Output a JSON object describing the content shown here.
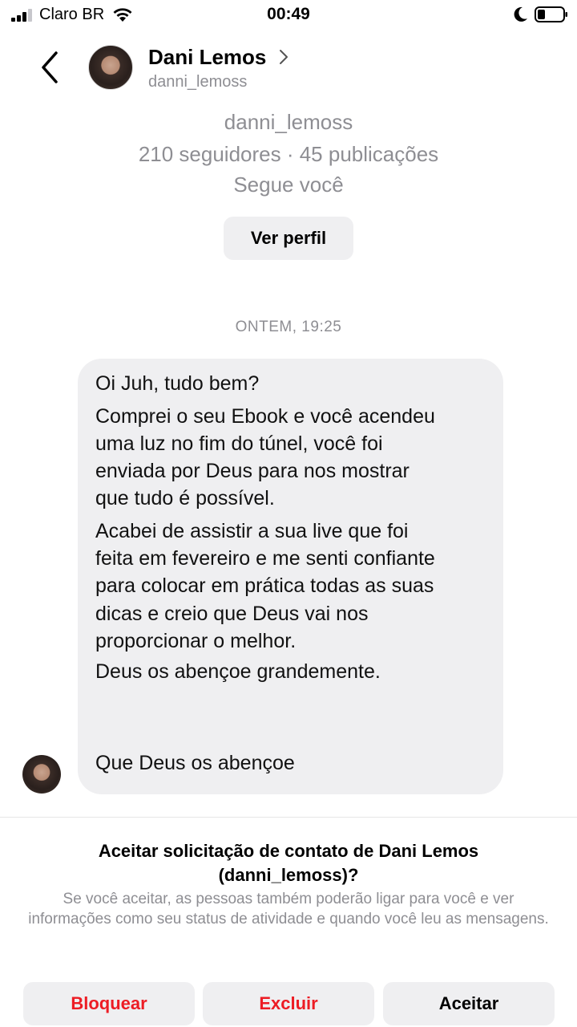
{
  "status_bar": {
    "carrier": "Claro BR",
    "time": "00:49"
  },
  "header": {
    "name": "Dani Lemos",
    "handle": "danni_lemoss"
  },
  "profile": {
    "handle": "danni_lemoss",
    "stats": "210 seguidores · 45 publicações",
    "follows_you": "Segue você",
    "view_profile_label": "Ver perfil"
  },
  "conversation": {
    "timestamp": "ONTEM, 19:25",
    "message_lines": [
      "Oi Juh, tudo bem?",
      "Comprei o seu Ebook e você acendeu",
      "uma luz no fim do túnel, você foi",
      "enviada por Deus para nos mostrar",
      "que tudo é possível.",
      "Acabei de assistir a sua live que foi",
      "feita em fevereiro e me senti confiante",
      "para colocar em prática todas as suas",
      "dicas e creio que Deus vai nos",
      "proporcionar o melhor.",
      "Deus os abençoe grandemente.",
      "Que Deus os abençoe"
    ]
  },
  "request": {
    "title": "Aceitar solicitação de contato de Dani Lemos (danni_lemoss)?",
    "description": "Se você aceitar, as pessoas também poderão ligar para você e ver informações como seu status de atividade e quando você leu as mensagens.",
    "block_label": "Bloquear",
    "delete_label": "Excluir",
    "accept_label": "Aceitar"
  },
  "colors": {
    "destructive": "#ed1c24",
    "secondary_text": "#8e8e93",
    "bubble": "#efeff1"
  }
}
